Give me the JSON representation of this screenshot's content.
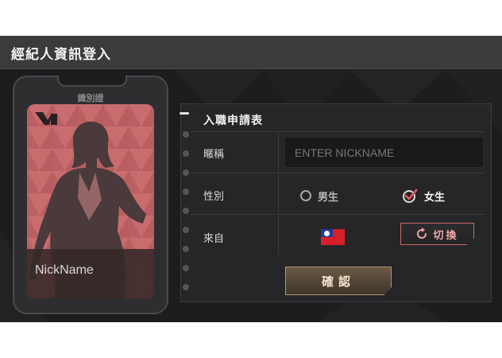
{
  "window": {
    "title": "經紀人資訊登入"
  },
  "badge": {
    "label": "識別證",
    "logo_icon": "yg-logo",
    "nickname": "NickName"
  },
  "form": {
    "title": "入職申請表",
    "nickname": {
      "label": "暱稱",
      "placeholder": "ENTER NICKNAME",
      "value": ""
    },
    "gender": {
      "label": "性別",
      "options": [
        {
          "label": "男生",
          "selected": false
        },
        {
          "label": "女生",
          "selected": true
        }
      ]
    },
    "origin": {
      "label": "來自",
      "flag_icon": "taiwan-flag-icon",
      "switch_label": "切換"
    },
    "confirm_label": "確認"
  },
  "colors": {
    "accent_pink": "#c06466",
    "button_gold": "#b29473",
    "background": "#1d1d1f"
  }
}
